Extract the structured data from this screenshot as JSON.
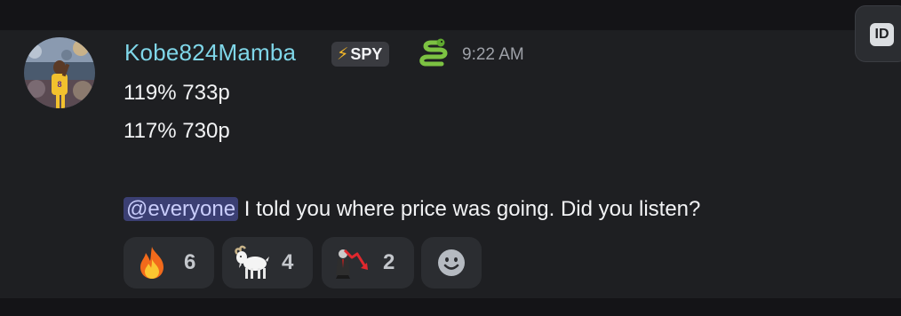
{
  "message": {
    "author": "Kobe824Mamba",
    "tag_label": "SPY",
    "timestamp": "9:22 AM",
    "lines": [
      "119% 733p",
      "117% 730p"
    ],
    "mention": "@everyone",
    "body": "I told you where price was going. Did you listen?"
  },
  "reactions": [
    {
      "emoji": "fire-emoji",
      "count": "6"
    },
    {
      "emoji": "goat-emoji",
      "count": "4"
    },
    {
      "emoji": "stock-down-emoji",
      "count": "2"
    }
  ],
  "toolbar": {
    "id_label": "ID"
  },
  "colors": {
    "username": "#7fd6e8",
    "mention_bg": "#3b3f73",
    "mention_text": "#c9cdfb",
    "reaction_bg": "#2b2d31"
  }
}
